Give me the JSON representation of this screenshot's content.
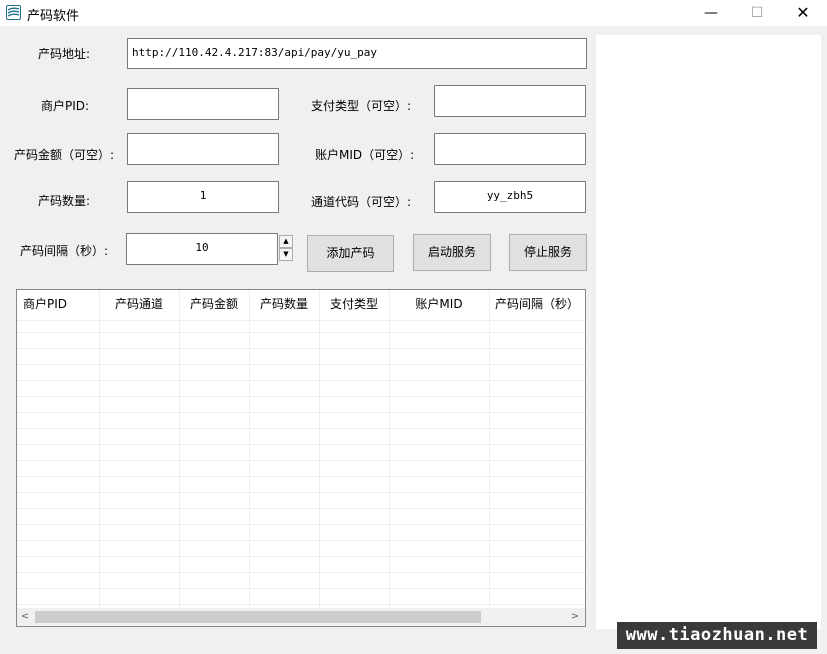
{
  "window": {
    "title": "产码软件",
    "minimize": "—",
    "maximize": "☐",
    "close": "✕"
  },
  "form": {
    "url_label": "产码地址:",
    "url_value": "http://110.42.4.217:83/api/pay/yu_pay",
    "merchant_pid_label": "商户PID:",
    "merchant_pid_value": "",
    "pay_type_label": "支付类型（可空）:",
    "pay_type_value": "",
    "amount_label": "产码金额（可空）:",
    "amount_value": "",
    "account_mid_label": "账户MID（可空）:",
    "account_mid_value": "",
    "quantity_label": "产码数量:",
    "quantity_value": "1",
    "channel_code_label": "通道代码（可空）:",
    "channel_code_value": "yy_zbh5",
    "interval_label": "产码间隔（秒）:",
    "interval_value": "10"
  },
  "buttons": {
    "add": "添加产码",
    "start": "启动服务",
    "stop": "停止服务"
  },
  "table": {
    "columns": [
      "商户PID",
      "产码通道",
      "产码金额",
      "产码数量",
      "支付类型",
      "账户MID",
      "产码间隔（秒）"
    ],
    "rows": []
  },
  "scroll": {
    "left_arrow": "<",
    "right_arrow": ">"
  },
  "watermark": "www.tiaozhuan.net"
}
